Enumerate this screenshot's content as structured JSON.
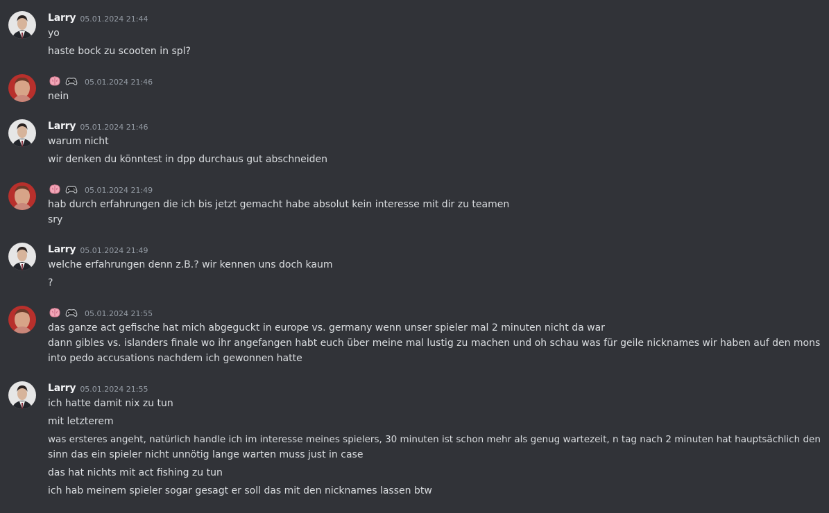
{
  "colors": {
    "background": "#313338",
    "text": "#dbdee1",
    "username": "#f2f3f5",
    "timestamp": "#949ba4"
  },
  "messages": [
    {
      "author": "Larry",
      "avatar": "larry-avatar",
      "timestamp": "05.01.2024 21:44",
      "lines": [
        "yo",
        "haste bock zu scooten in spl?"
      ]
    },
    {
      "author": "",
      "badges": [
        "brain-icon",
        "gamepad-icon"
      ],
      "avatar": "red-avatar",
      "timestamp": "05.01.2024 21:46",
      "lines": [
        "nein"
      ]
    },
    {
      "author": "Larry",
      "avatar": "larry-avatar",
      "timestamp": "05.01.2024 21:46",
      "lines": [
        "warum nicht",
        "wir denken du könntest in dpp durchaus gut abschneiden"
      ]
    },
    {
      "author": "",
      "badges": [
        "brain-icon",
        "gamepad-icon"
      ],
      "avatar": "red-avatar",
      "timestamp": "05.01.2024 21:49",
      "lines": [
        "hab durch erfahrungen die ich bis jetzt gemacht habe absolut kein interesse mit dir zu teamen",
        "sry"
      ]
    },
    {
      "author": "Larry",
      "avatar": "larry-avatar",
      "timestamp": "05.01.2024 21:49",
      "lines": [
        "welche erfahrungen denn z.B.? wir kennen uns doch kaum",
        "?"
      ]
    },
    {
      "author": "",
      "badges": [
        "brain-icon",
        "gamepad-icon"
      ],
      "avatar": "red-avatar",
      "timestamp": "05.01.2024 21:55",
      "lines": [
        "das ganze act gefische hat mich abgeguckt in europe vs. germany wenn unser spieler mal 2 minuten nicht da war",
        "dann gibles vs. islanders finale wo ihr angefangen habt euch über meine mal lustig zu machen und oh schau was für geile nicknames wir haben auf den mons",
        "into pedo accusations nachdem ich gewonnen hatte"
      ]
    },
    {
      "author": "Larry",
      "avatar": "larry-avatar",
      "timestamp": "05.01.2024 21:55",
      "lines": [
        "ich hatte damit nix zu tun",
        "mit letzterem",
        "was ersteres angeht, natürlich handle ich im interesse meines spielers, 30 minuten ist schon mehr als genug wartezeit, n tag nach 2 minuten hat hauptsächlich den",
        "sinn das ein spieler nicht unnötig lange warten muss just in case",
        "das hat nichts mit act fishing zu tun",
        "ich hab meinem spieler sogar gesagt er soll das mit den nicknames lassen btw"
      ]
    }
  ]
}
